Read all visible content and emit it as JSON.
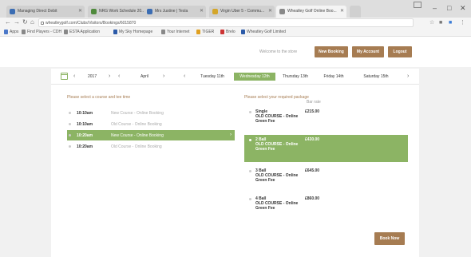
{
  "browser": {
    "tabs": [
      {
        "label": "Managing Direct Debit",
        "color": "#3b6db3"
      },
      {
        "label": "NRG Work Schedule 20...",
        "color": "#4f8a3c"
      },
      {
        "label": "Mrs Justine | Tesla",
        "color": "#3b6db3"
      },
      {
        "label": "Virgin Uber 5 - Commu...",
        "color": "#d4a62a"
      },
      {
        "label": "Wheatley Golf Online Boo...",
        "color": "#888888"
      }
    ],
    "url": "wheatleygolf.com/Clubs/Visitors/Bookings/6015870",
    "bookmarks": [
      {
        "label": "Apps",
        "color": "#4a77c8"
      },
      {
        "label": "Find Players - CDH",
        "color": "#888888"
      },
      {
        "label": "ESTA Application",
        "color": "#888888"
      },
      {
        "label": "My Sky Homepage",
        "color": "#2b5aa8"
      },
      {
        "label": "Your Internet",
        "color": "#888888"
      },
      {
        "label": "TIGER",
        "color": "#e0a020"
      },
      {
        "label": "Brelo",
        "color": "#cc3333"
      },
      {
        "label": "Wheatley Golf Limited",
        "color": "#2b5aa8"
      }
    ]
  },
  "header": {
    "welcome": "Welcome to the store",
    "new_booking": "New Booking",
    "my_account": "My Account",
    "logout": "Logout"
  },
  "datebar": {
    "year": "2017",
    "month": "April",
    "days": [
      {
        "label": "Tuesday 11th",
        "selected": false
      },
      {
        "label": "Wednesday 12th",
        "selected": true
      },
      {
        "label": "Thursday 13th",
        "selected": false
      },
      {
        "label": "Friday 14th",
        "selected": false
      },
      {
        "label": "Saturday 15th",
        "selected": false
      }
    ]
  },
  "tee_times": {
    "heading": "Please select a course and tee time",
    "rows": [
      {
        "time": "10:10am",
        "course": "New Course - Online Booking",
        "selected": false
      },
      {
        "time": "10:10am",
        "course": "Old Course - Online Booking",
        "selected": false
      },
      {
        "time": "10:20am",
        "course": "New Course - Online Booking",
        "selected": true
      },
      {
        "time": "10:20am",
        "course": "Old Course - Online Booking",
        "selected": false
      }
    ]
  },
  "packages": {
    "heading": "Please select your required package",
    "price_header": "Bar rate",
    "items": [
      {
        "name": "Single",
        "course": "OLD COURSE - Online",
        "fee": "Green Fee",
        "price": "£215.00",
        "selected": false
      },
      {
        "name": "2 Ball",
        "course": "OLD COURSE - Online",
        "fee": "Green Fee",
        "price": "£430.00",
        "selected": true
      },
      {
        "name": "3 Ball",
        "course": "OLD COURSE - Online",
        "fee": "Green Fee",
        "price": "£645.00",
        "selected": false
      },
      {
        "name": "4 Ball",
        "course": "OLD COURSE - Online",
        "fee": "Green Fee",
        "price": "£860.00",
        "selected": false
      }
    ],
    "book_now": "Book Now"
  }
}
